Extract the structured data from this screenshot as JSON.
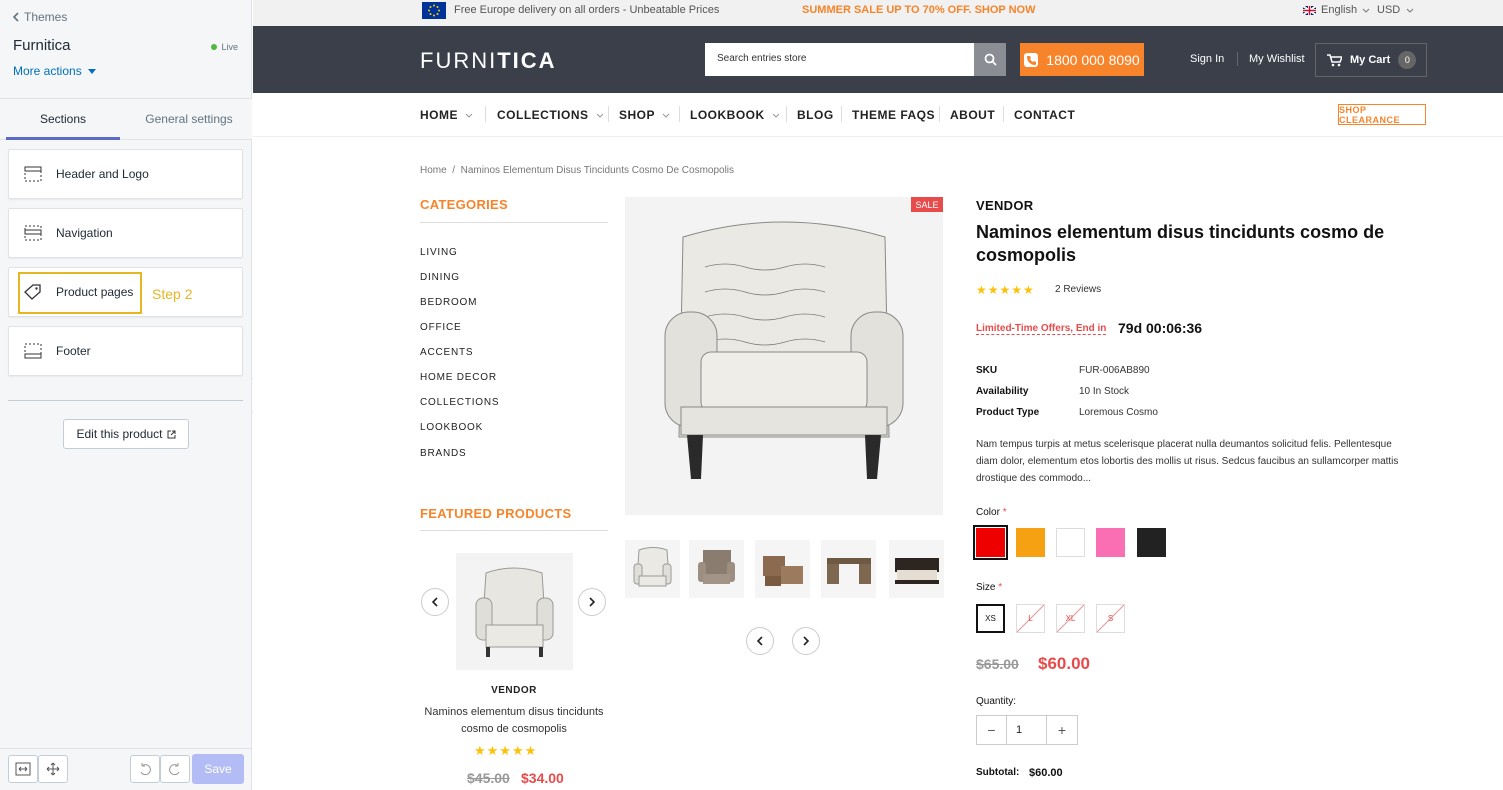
{
  "editor": {
    "back_label": "Themes",
    "theme_name": "Furnitica",
    "status": "Live",
    "more_actions": "More actions",
    "tabs": [
      {
        "label": "Sections"
      },
      {
        "label": "General settings"
      }
    ],
    "sections": [
      {
        "label": "Header and Logo",
        "icon": "header-layout-icon"
      },
      {
        "label": "Navigation",
        "icon": "navigation-layout-icon"
      },
      {
        "label": "Product pages",
        "icon": "tag-icon"
      },
      {
        "label": "Footer",
        "icon": "footer-layout-icon"
      }
    ],
    "step_label": "Step 2",
    "edit_product": "Edit this product",
    "save": "Save"
  },
  "store": {
    "topbar": {
      "delivery": "Free Europe delivery on all orders - Unbeatable Prices",
      "sale": "SUMMER SALE UP TO 70% OFF. SHOP NOW",
      "language": "English",
      "currency": "USD"
    },
    "header": {
      "logo_light": "FURNI",
      "logo_bold": "TICA",
      "search_placeholder": "Search entries store",
      "phone": "1800 000 8090",
      "sign_in": "Sign In",
      "wishlist": "My Wishlist",
      "cart": "My Cart",
      "cart_count": "0"
    },
    "nav": [
      {
        "label": "HOME"
      },
      {
        "label": "COLLECTIONS"
      },
      {
        "label": "SHOP"
      },
      {
        "label": "LOOKBOOK"
      },
      {
        "label": "BLOG"
      },
      {
        "label": "THEME FAQS"
      },
      {
        "label": "ABOUT"
      },
      {
        "label": "CONTACT"
      }
    ],
    "shop_clearance": "SHOP CLEARANCE",
    "breadcrumb": {
      "home": "Home",
      "sep": "/",
      "current": "Naminos Elementum Disus Tincidunts Cosmo De Cosmopolis"
    },
    "categories_title": "CATEGORIES",
    "categories": [
      "LIVING",
      "DINING",
      "BEDROOM",
      "OFFICE",
      "ACCENTS",
      "HOME DECOR",
      "COLLECTIONS",
      "LOOKBOOK",
      "BRANDS"
    ],
    "featured": {
      "title": "FEATURED PRODUCTS",
      "vendor": "VENDOR",
      "name": "Naminos elementum disus tincidunts cosmo de cosmopolis",
      "stars": "★★★★★",
      "old_price": "$45.00",
      "price": "$34.00"
    },
    "product": {
      "sale_badge": "SALE",
      "vendor": "VENDOR",
      "title": "Naminos elementum disus tincidunts cosmo de cosmopolis",
      "stars": "★★★★★",
      "reviews": "2 Reviews",
      "offer_label": "Limited-Time Offers, End in",
      "countdown": "79d 00:06:36",
      "specs": [
        {
          "label": "SKU",
          "value": "FUR-006AB890"
        },
        {
          "label": "Availability",
          "value": "10 In Stock"
        },
        {
          "label": "Product Type",
          "value": "Loremous Cosmo"
        }
      ],
      "description": "Nam tempus turpis at metus scelerisque placerat nulla deumantos solicitud felis. Pellentesque diam dolor, elementum etos lobortis des mollis ut risus. Sedcus faucibus an sullamcorper mattis drostique des commodo...",
      "color_label": "Color",
      "required": "*",
      "colors": [
        "#ee0000",
        "#f5a112",
        "#ffffff",
        "#fa6eb4",
        "#222222"
      ],
      "size_label": "Size",
      "sizes": [
        "XS",
        "L",
        "XL",
        "S"
      ],
      "old_price": "$65.00",
      "price": "$60.00",
      "quantity_label": "Quantity:",
      "quantity": "1",
      "minus": "−",
      "plus": "+",
      "subtotal_label": "Subtotal:",
      "subtotal": "$60.00"
    }
  }
}
